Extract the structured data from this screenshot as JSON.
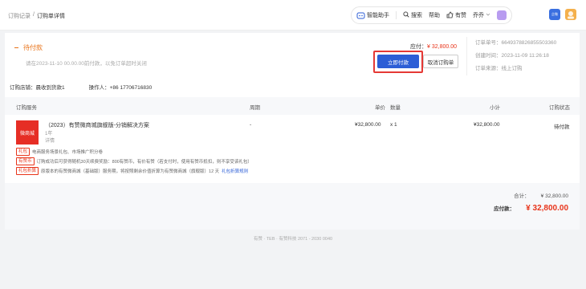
{
  "breadcrumb": {
    "parent": "订购记录",
    "sep": "/",
    "current": "订购单详情"
  },
  "toolbar": {
    "assistant": "智能助手",
    "search": "搜索",
    "help": "帮助",
    "brand": "有赞",
    "user": "乔乔",
    "app_badge": "企微"
  },
  "status": {
    "title": "待付款",
    "desc": "请在2023-11-10 00.00.00前付款，以免订单超时关闭",
    "pay_label": "应付：",
    "pay_value": "¥ 32,800.00",
    "pay_button": "立即付款",
    "cancel_button": "取消订购单"
  },
  "meta": {
    "order_no_label": "订单单号：",
    "order_no": "6649378826855503360",
    "created_label": "创建时间：",
    "created": "2023-11-09 11:26:18",
    "source_label": "订单来源：",
    "source": "线上订购"
  },
  "info": {
    "shop_label": "订购店铺：",
    "shop": "晨收到货款1",
    "operator_label": "操作人：",
    "operator": "+86 17706716830"
  },
  "table": {
    "headers": {
      "service": "订购服务",
      "period": "周期",
      "price": "单价",
      "qty": "数量",
      "subtotal": "小计",
      "status": "订购状态"
    },
    "row": {
      "img_label": "微商城",
      "name": "（2023）有赞微商城旗舰版-分销解决方案",
      "term": "1年",
      "detail": "详情",
      "period": "-",
      "price": "¥32,800.00",
      "qty": "x 1",
      "subtotal": "¥32,800.00",
      "status": "待付款"
    },
    "tags": [
      {
        "tag": "礼包",
        "text": "电商服务场景礼包、市场推广积分卷",
        "link": ""
      },
      {
        "tag": "有赞币",
        "text": "订购成功后可获得随机30天续费奖励：800有赞币，有价有赞（若支付时，使用有赞币抵扣，则不享受该礼包）",
        "link": ""
      },
      {
        "tag": "礼包折算",
        "text": "原版本的有赞微商城（基础版）服务期，将按照剩余价值折算为有赞微商城（旗舰版）12 天",
        "link": "礼包折算规则"
      }
    ]
  },
  "summary": {
    "total_label": "合计：",
    "total": "¥ 32,800.00",
    "due_label": "应付款：",
    "due": "¥ 32,800.00"
  },
  "footer": {
    "text": "有赞  ·  TEB · 有赞科技 2071 - 2030 0040"
  }
}
